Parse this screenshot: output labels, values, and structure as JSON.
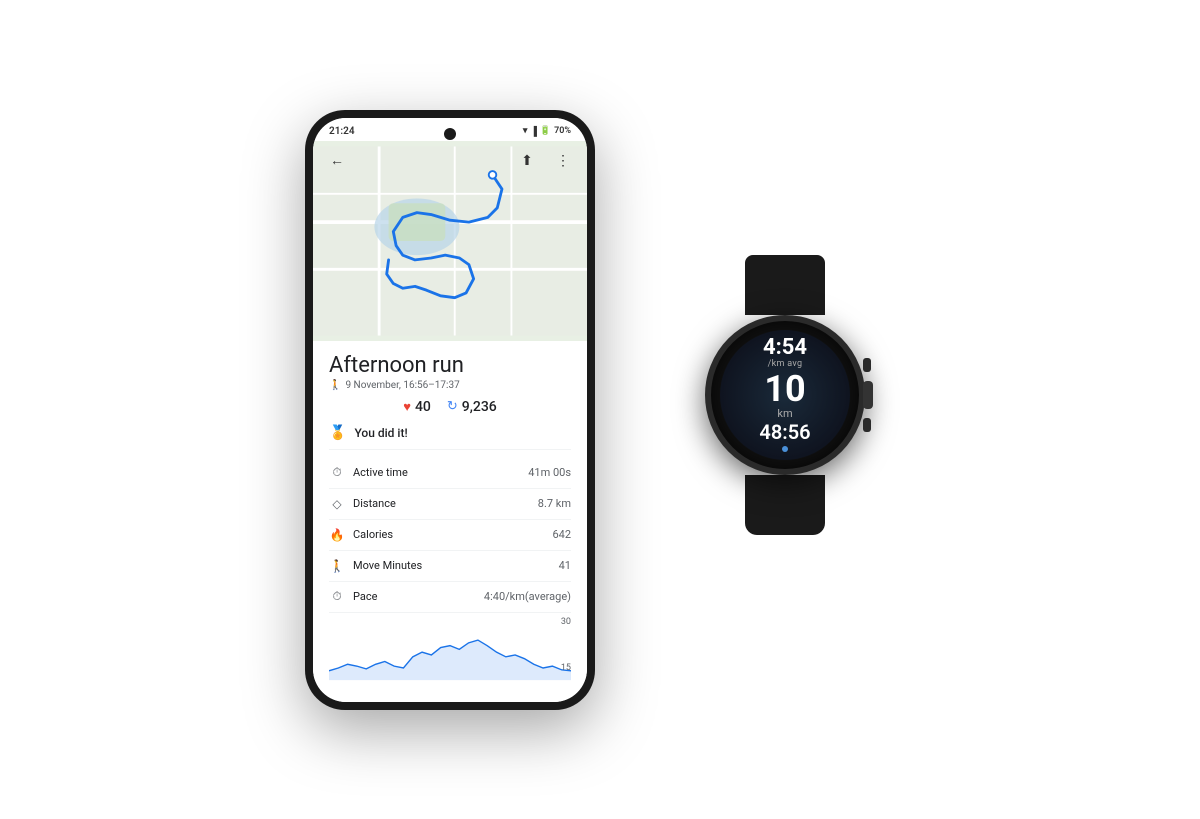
{
  "phone": {
    "status_time": "21:24",
    "status_battery": "70%",
    "map": {
      "description": "Running route map"
    },
    "activity": {
      "title": "Afternoon run",
      "date": "9 November, 16:56–17:37",
      "heart_points": "40",
      "steps": "9,236",
      "achievement": "You did it!",
      "metrics": [
        {
          "icon": "⏱",
          "label": "Active time",
          "value": "41m 00s"
        },
        {
          "icon": "◇",
          "label": "Distance",
          "value": "8.7 km"
        },
        {
          "icon": "🔥",
          "label": "Calories",
          "value": "642"
        },
        {
          "icon": "🚶",
          "label": "Move Minutes",
          "value": "41"
        },
        {
          "icon": "⏱",
          "label": "Pace",
          "value": "4:40/km(average)"
        }
      ],
      "chart_top_label": "30",
      "chart_bottom_label": "15"
    },
    "toolbar": {
      "back": "←",
      "share": "⬆",
      "more": "⋮"
    }
  },
  "watch": {
    "pace": "4:54",
    "pace_label": "/km avg",
    "distance": "10",
    "distance_unit": "km",
    "elapsed_time": "48:56"
  }
}
